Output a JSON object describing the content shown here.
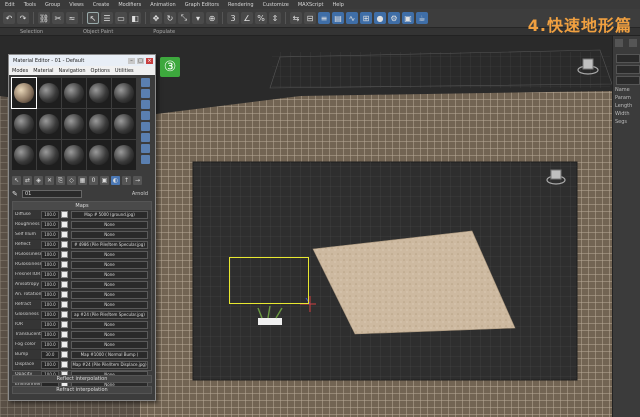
{
  "menubar": [
    "Edit",
    "Tools",
    "Group",
    "Views",
    "Create",
    "Modifiers",
    "Animation",
    "Graph Editors",
    "Rendering",
    "Customize",
    "MAXScript",
    "Help"
  ],
  "toolbar": {
    "buttons": [
      "undo",
      "redo",
      "link",
      "unlink",
      "bind",
      "select",
      "select-name",
      "rect-select",
      "window",
      "move",
      "rotate",
      "scale",
      "ref-coord",
      "pivot",
      "snaps",
      "angle-snap",
      "percent-snap",
      "spinner-snap",
      "named-sel",
      "mirror",
      "align",
      "layers",
      "ribbon",
      "curve-editor",
      "schematic",
      "material-editor",
      "render-setup",
      "render-frame",
      "render"
    ]
  },
  "ribbon": [
    "Selection",
    "Object Paint",
    "Populate"
  ],
  "overlay_title": "4.快速地形篇",
  "step_badge": "③",
  "material_editor": {
    "title": "Material Editor - 01 - Default",
    "menu": [
      "Modes",
      "Material",
      "Navigation",
      "Options",
      "Utilities"
    ],
    "name_field": "01",
    "name_label": "Arnold",
    "maps_header": "Maps",
    "maps": [
      {
        "label": "Diffuse",
        "value": "100.0",
        "slot": "Map # 5000 (ground.jpg)"
      },
      {
        "label": "Roughness",
        "value": "100.0",
        "slot": "None"
      },
      {
        "label": "Self Illum",
        "value": "100.0",
        "slot": "None"
      },
      {
        "label": "Reflect",
        "value": "100.0",
        "slot": "# 4986 (Pile Pile/Item Specular.jpg)"
      },
      {
        "label": "HGlossiness",
        "value": "100.0",
        "slot": "None"
      },
      {
        "label": "RGlossiness",
        "value": "100.0",
        "slot": "None"
      },
      {
        "label": "Fresnel IOR",
        "value": "100.0",
        "slot": "None"
      },
      {
        "label": "Anisotropy",
        "value": "100.0",
        "slot": "None"
      },
      {
        "label": "An. rotation",
        "value": "100.0",
        "slot": "None"
      },
      {
        "label": "Refract",
        "value": "100.0",
        "slot": "None"
      },
      {
        "label": "Glossiness",
        "value": "100.0",
        "slot": "ap #24 (Pile Pile/Item Specular.jpg)"
      },
      {
        "label": "IOR",
        "value": "100.0",
        "slot": "None"
      },
      {
        "label": "Translucent",
        "value": "100.0",
        "slot": "None"
      },
      {
        "label": "Fog color",
        "value": "100.0",
        "slot": "None"
      },
      {
        "label": "Bump",
        "value": "30.0",
        "slot": "Map #1000 ( Normal Bump )"
      },
      {
        "label": "Displace",
        "value": "100.0",
        "slot": "Map #24 (Pile Pile/Item Displace.jpg)"
      },
      {
        "label": "Opacity",
        "value": "100.0",
        "slot": "None"
      },
      {
        "label": "Environment",
        "value": "",
        "slot": "None"
      }
    ],
    "rollouts": [
      "Reflect interpolation",
      "Refract interpolation"
    ]
  },
  "right_panel": {
    "labels": [
      "Name",
      "Param",
      "Length",
      "Width",
      "Segs"
    ]
  }
}
